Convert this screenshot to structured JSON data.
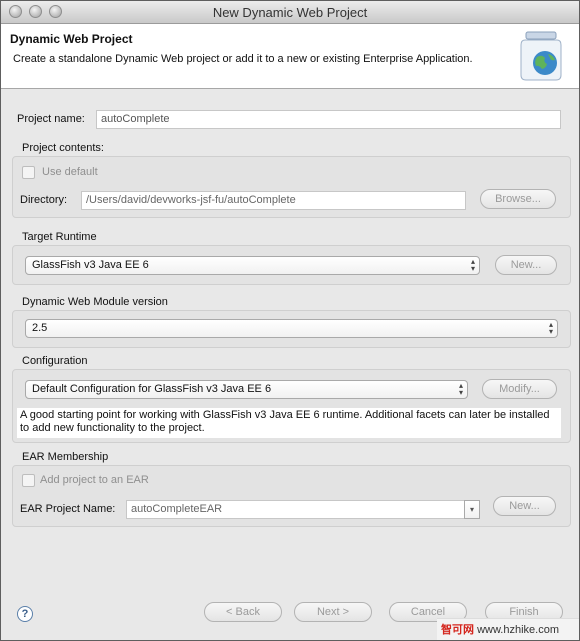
{
  "window": {
    "title": "New Dynamic Web Project"
  },
  "banner": {
    "title": "Dynamic Web Project",
    "description": "Create a standalone Dynamic Web project or add it to a new or existing Enterprise Application.",
    "icon": "jar-globe-icon"
  },
  "project_name": {
    "label": "Project name:",
    "value": "autoComplete"
  },
  "project_contents": {
    "title": "Project contents:",
    "use_default_label": "Use default",
    "use_default_checked": false,
    "directory_label": "Directory:",
    "directory_value": "/Users/david/devworks-jsf-fu/autoComplete",
    "browse_label": "Browse..."
  },
  "target_runtime": {
    "title": "Target Runtime",
    "selected": "GlassFish v3 Java EE 6",
    "new_label": "New..."
  },
  "module_version": {
    "title": "Dynamic Web Module version",
    "selected": "2.5"
  },
  "configuration": {
    "title": "Configuration",
    "selected": "Default Configuration for GlassFish v3 Java EE 6",
    "modify_label": "Modify...",
    "description": "A good starting point for working with GlassFish v3 Java EE 6 runtime. Additional facets can later be installed to add new functionality to the project."
  },
  "ear": {
    "title": "EAR Membership",
    "add_label": "Add project to an EAR",
    "add_checked": false,
    "name_label": "EAR Project Name:",
    "name_value": "autoCompleteEAR",
    "new_label": "New..."
  },
  "footer": {
    "help_glyph": "?",
    "back_label": "< Back",
    "next_label": "Next >",
    "cancel_label": "Cancel",
    "finish_label": "Finish"
  },
  "watermark": {
    "prefix": "智可网",
    "url": "www.hzhike.com"
  },
  "colors": {
    "disabled_text": "#9a9a9a",
    "banner_bg": "#ffffff",
    "dialog_bg": "#e8e8e8"
  }
}
